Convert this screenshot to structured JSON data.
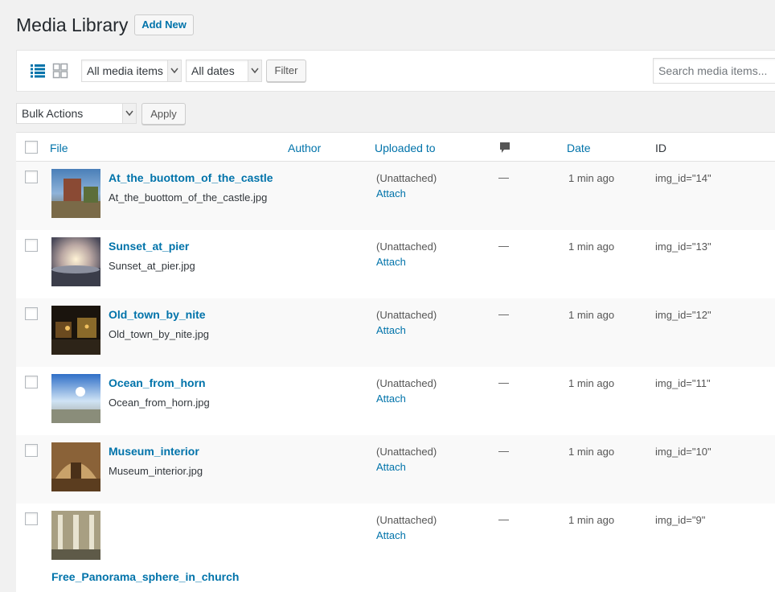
{
  "header": {
    "title": "Media Library",
    "add_new_label": "Add New"
  },
  "toolbar": {
    "view_list_icon": "list-view-icon",
    "view_grid_icon": "grid-view-icon",
    "media_filter_value": "All media items",
    "date_filter_value": "All dates",
    "filter_label": "Filter",
    "search_placeholder": "Search media items..."
  },
  "bulk": {
    "action_value": "Bulk Actions",
    "apply_label": "Apply"
  },
  "columns": {
    "file": "File",
    "author": "Author",
    "uploaded_to": "Uploaded to",
    "comments_icon": "comment-bubble-icon",
    "date": "Date",
    "id": "ID"
  },
  "rows": [
    {
      "title": "At_the_buottom_of_the_castle",
      "filename": "At_the_buottom_of_the_castle.jpg",
      "uploaded_to": "(Unattached)",
      "attach": "Attach",
      "comments": "—",
      "date": "1 min ago",
      "id": "img_id=\"14\""
    },
    {
      "title": "Sunset_at_pier",
      "filename": "Sunset_at_pier.jpg",
      "uploaded_to": "(Unattached)",
      "attach": "Attach",
      "comments": "—",
      "date": "1 min ago",
      "id": "img_id=\"13\""
    },
    {
      "title": "Old_town_by_nite",
      "filename": "Old_town_by_nite.jpg",
      "uploaded_to": "(Unattached)",
      "attach": "Attach",
      "comments": "—",
      "date": "1 min ago",
      "id": "img_id=\"12\""
    },
    {
      "title": "Ocean_from_horn",
      "filename": "Ocean_from_horn.jpg",
      "uploaded_to": "(Unattached)",
      "attach": "Attach",
      "comments": "—",
      "date": "1 min ago",
      "id": "img_id=\"11\""
    },
    {
      "title": "Museum_interior",
      "filename": "Museum_interior.jpg",
      "uploaded_to": "(Unattached)",
      "attach": "Attach",
      "comments": "—",
      "date": "1 min ago",
      "id": "img_id=\"10\""
    },
    {
      "title": "Free_Panorama_sphere_in_church",
      "uploaded_to": "(Unattached)",
      "attach": "Attach",
      "comments": "—",
      "date": "1 min ago",
      "id": "img_id=\"9\""
    }
  ],
  "colors": {
    "link": "#0073aa",
    "page_bg": "#f1f1f1",
    "row_alt": "#f9f9f9"
  }
}
